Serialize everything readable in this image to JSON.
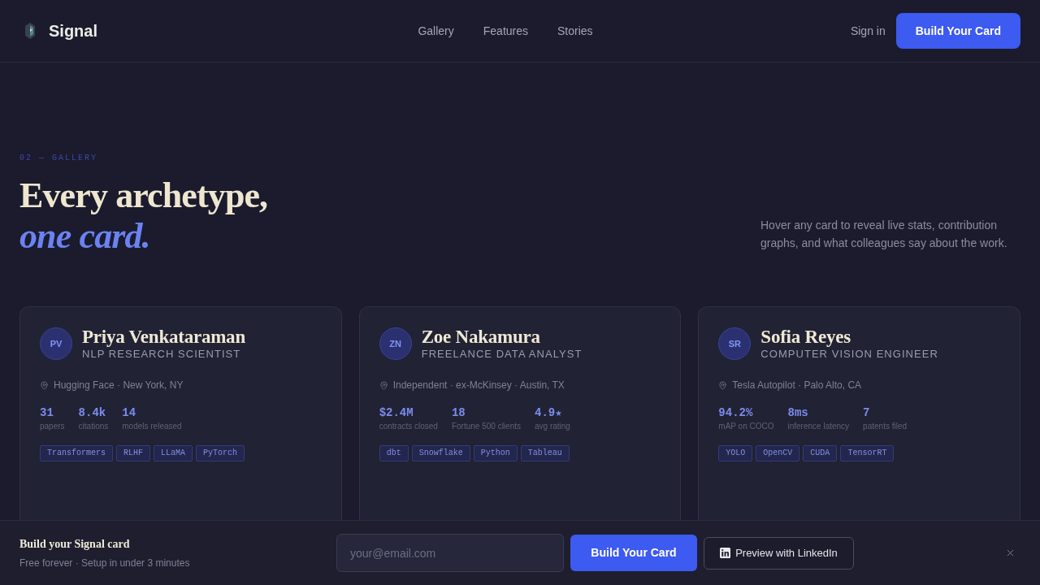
{
  "nav": {
    "brand": "Signal",
    "links": [
      "Gallery",
      "Features",
      "Stories"
    ],
    "sign_in": "Sign in",
    "cta": "Build Your Card"
  },
  "hero": {
    "eyebrow": "02 — GALLERY",
    "title": "Every archetype,",
    "title_accent": "one card.",
    "description": "Hover any card to reveal live stats, contribution graphs, and what colleagues say about the work."
  },
  "cards": [
    {
      "initials": "PV",
      "name": "Priya Venkataraman",
      "role": "NLP RESEARCH SCIENTIST",
      "location": "Hugging Face · New York, NY",
      "stats": [
        {
          "value": "31",
          "label": "papers"
        },
        {
          "value": "8.4k",
          "label": "citations"
        },
        {
          "value": "14",
          "label": "models released"
        }
      ],
      "tags": [
        "Transformers",
        "RLHF",
        "LLaMA",
        "PyTorch"
      ]
    },
    {
      "initials": "ZN",
      "name": "Zoe Nakamura",
      "role": "FREELANCE DATA ANALYST",
      "location": "Independent · ex-McKinsey · Austin, TX",
      "stats": [
        {
          "value": "$2.4M",
          "label": "contracts closed"
        },
        {
          "value": "18",
          "label": "Fortune 500 clients"
        },
        {
          "value": "4.9★",
          "label": "avg rating"
        }
      ],
      "tags": [
        "dbt",
        "Snowflake",
        "Python",
        "Tableau"
      ]
    },
    {
      "initials": "SR",
      "name": "Sofia Reyes",
      "role": "COMPUTER VISION ENGINEER",
      "location": "Tesla Autopilot · Palo Alto, CA",
      "stats": [
        {
          "value": "94.2%",
          "label": "mAP on COCO"
        },
        {
          "value": "8ms",
          "label": "inference latency"
        },
        {
          "value": "7",
          "label": "patents filed"
        }
      ],
      "tags": [
        "YOLO",
        "OpenCV",
        "CUDA",
        "TensorRT"
      ]
    }
  ],
  "signup_bar": {
    "title": "Build your Signal card",
    "subtitle": "Free forever · Setup in under 3 minutes",
    "placeholder": "your@email.com",
    "submit": "Build Your Card",
    "secondary": "Preview with LinkedIn"
  }
}
